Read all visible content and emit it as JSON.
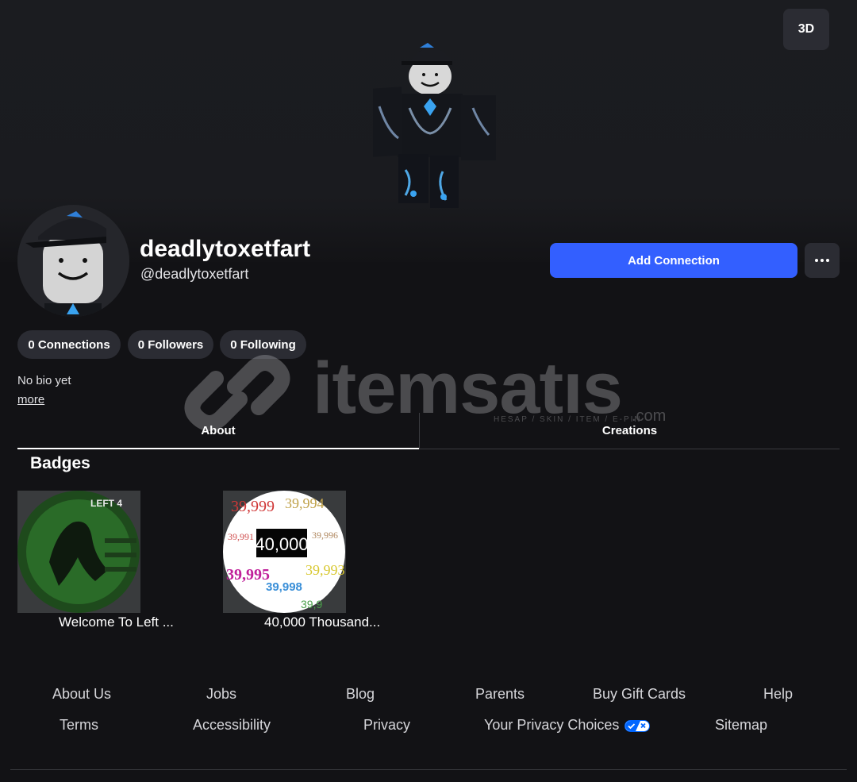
{
  "hero": {
    "view_toggle_label": "3D"
  },
  "profile": {
    "display_name": "deadlytoxetfart",
    "username": "@deadlytoxetfart",
    "add_connection_label": "Add Connection",
    "bio": "No bio yet",
    "more_label": "more"
  },
  "stats": [
    {
      "label": "0 Connections"
    },
    {
      "label": "0 Followers"
    },
    {
      "label": "0 Following"
    }
  ],
  "watermark": {
    "brand": "itemsatıs",
    "tagline": "HESAP / SKIN / ITEM / E-PIN",
    "suffix": ".com"
  },
  "tabs": [
    {
      "label": "About",
      "active": true
    },
    {
      "label": "Creations",
      "active": false
    }
  ],
  "badges": {
    "title": "Badges",
    "items": [
      {
        "name": "Welcome To Left ...",
        "art_text": "LEFT 4"
      },
      {
        "name": "40,000 Thousand...",
        "art_text": "40,000"
      }
    ]
  },
  "footer": {
    "row1": [
      "About Us",
      "Jobs",
      "Blog",
      "Parents",
      "Buy Gift Cards",
      "Help"
    ],
    "row2": [
      "Terms",
      "Accessibility",
      "Privacy",
      "Your Privacy Choices",
      "Sitemap"
    ]
  },
  "colors": {
    "background": "#121215",
    "accent": "#335fff",
    "surface": "#2b2c33"
  }
}
